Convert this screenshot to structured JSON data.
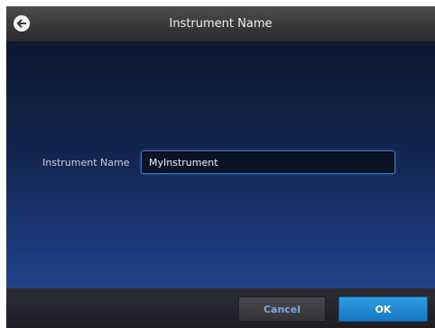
{
  "header": {
    "title": "Instrument Name",
    "back_icon": "back-arrow-icon"
  },
  "form": {
    "label": "Instrument Name",
    "value": "MyInstrument"
  },
  "footer": {
    "cancel_label": "Cancel",
    "ok_label": "OK"
  },
  "colors": {
    "accent": "#1e88d6",
    "input_border": "#3f74c9",
    "cancel_text": "#7fa7e0"
  }
}
